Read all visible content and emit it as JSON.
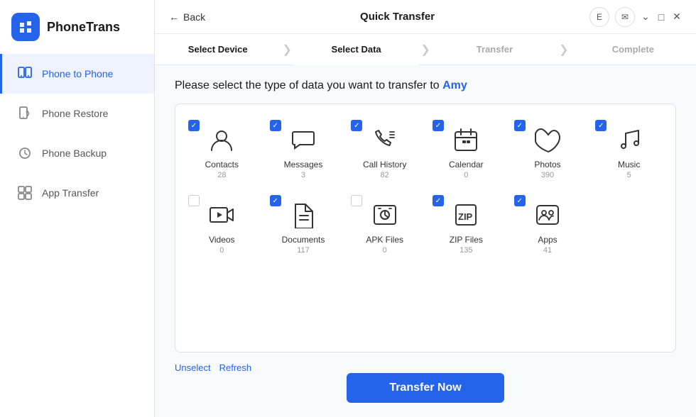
{
  "app": {
    "name": "PhoneTrans"
  },
  "sidebar": {
    "items": [
      {
        "id": "phone-to-phone",
        "label": "Phone to Phone",
        "active": true
      },
      {
        "id": "phone-restore",
        "label": "Phone Restore",
        "active": false
      },
      {
        "id": "phone-backup",
        "label": "Phone Backup",
        "active": false
      },
      {
        "id": "app-transfer",
        "label": "App Transfer",
        "active": false
      }
    ]
  },
  "titlebar": {
    "back_label": "Back",
    "title": "Quick Transfer",
    "avatar_label": "E"
  },
  "steps": [
    {
      "id": "select-device",
      "label": "Select Device",
      "state": "done"
    },
    {
      "id": "select-data",
      "label": "Select Data",
      "state": "active"
    },
    {
      "id": "transfer",
      "label": "Transfer",
      "state": "inactive"
    },
    {
      "id": "complete",
      "label": "Complete",
      "state": "inactive"
    }
  ],
  "content": {
    "prompt_prefix": "Please select the type of data you want to transfer to ",
    "target_name": "Amy",
    "data_items": [
      {
        "id": "contacts",
        "label": "Contacts",
        "count": "28",
        "checked": true
      },
      {
        "id": "messages",
        "label": "Messages",
        "count": "3",
        "checked": true
      },
      {
        "id": "call-history",
        "label": "Call History",
        "count": "82",
        "checked": true
      },
      {
        "id": "calendar",
        "label": "Calendar",
        "count": "0",
        "checked": true
      },
      {
        "id": "photos",
        "label": "Photos",
        "count": "390",
        "checked": true
      },
      {
        "id": "music",
        "label": "Music",
        "count": "5",
        "checked": true
      },
      {
        "id": "videos",
        "label": "Videos",
        "count": "0",
        "checked": false
      },
      {
        "id": "documents",
        "label": "Documents",
        "count": "117",
        "checked": true
      },
      {
        "id": "apk-files",
        "label": "APK Files",
        "count": "0",
        "checked": false
      },
      {
        "id": "zip-files",
        "label": "ZIP Files",
        "count": "135",
        "checked": true
      },
      {
        "id": "apps",
        "label": "Apps",
        "count": "41",
        "checked": true
      }
    ],
    "unselect_label": "Unselect",
    "refresh_label": "Refresh",
    "transfer_now_label": "Transfer Now"
  }
}
